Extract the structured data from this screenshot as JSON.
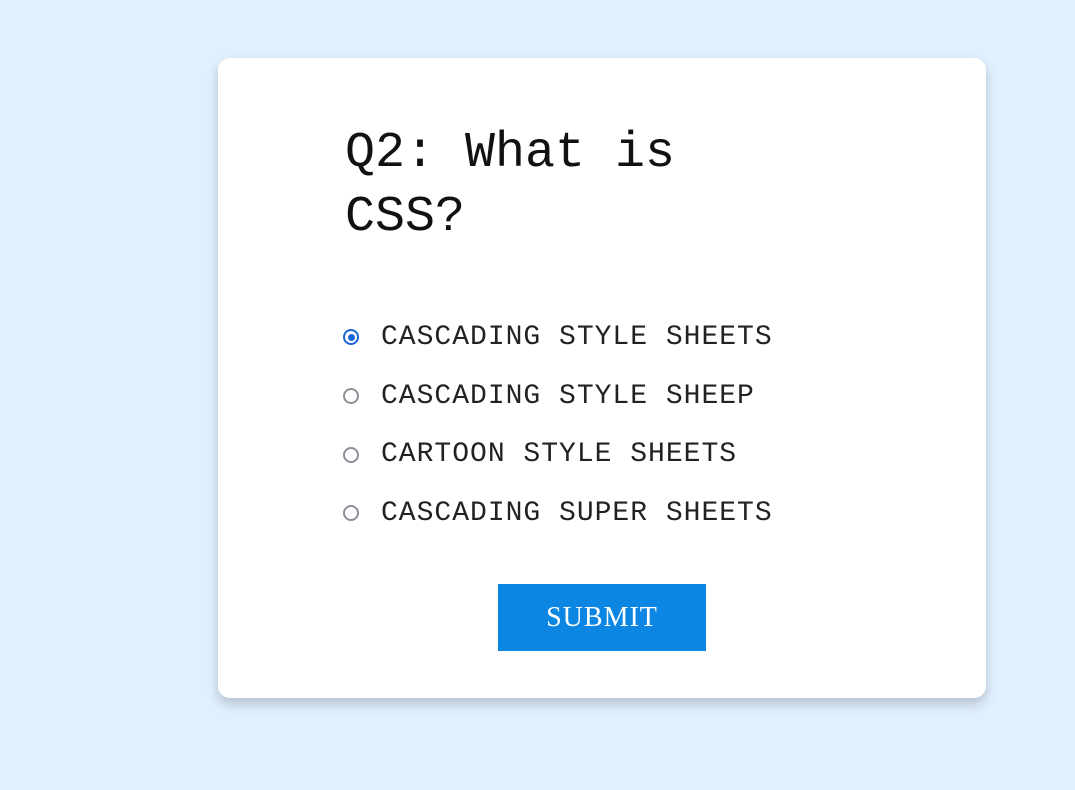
{
  "quiz": {
    "question": "Q2: What is CSS?",
    "options": [
      {
        "label": "CASCADING STYLE SHEETS",
        "selected": true
      },
      {
        "label": "CASCADING STYLE SHEEP",
        "selected": false
      },
      {
        "label": "CARTOON STYLE SHEETS",
        "selected": false
      },
      {
        "label": "CASCADING SUPER SHEETS",
        "selected": false
      }
    ],
    "submit_label": "SUBMIT"
  },
  "colors": {
    "page_background": "#e1f0ff",
    "card_background": "#ffffff",
    "radio_selected": "#1a66d9",
    "radio_unselected": "#8f8f99",
    "submit_background": "#0c86e3",
    "submit_text": "#ffffff"
  }
}
